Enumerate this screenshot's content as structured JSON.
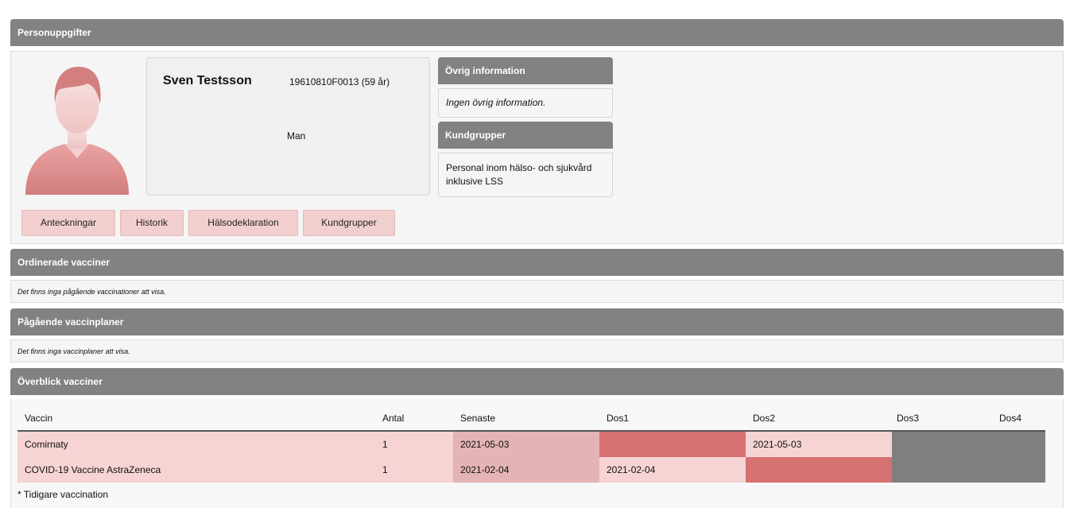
{
  "personal": {
    "header": "Personuppgifter",
    "name": "Sven Testsson",
    "id": "19610810F0013 (59 år)",
    "gender": "Man"
  },
  "other_info": {
    "header": "Övrig information",
    "text": "Ingen övrig information."
  },
  "customer_groups": {
    "header": "Kundgrupper",
    "text": "Personal inom hälso- och sjukvård inklusive LSS"
  },
  "buttons": {
    "notes": "Anteckningar",
    "history": "Historik",
    "health_declaration": "Hälsodeklaration",
    "customer_groups": "Kundgrupper"
  },
  "ordered": {
    "header": "Ordinerade vacciner",
    "empty": "Det finns inga pågående vaccinationer att visa."
  },
  "plans": {
    "header": "Pågående vaccinplaner",
    "empty": "Det finns inga vaccinplaner att visa."
  },
  "overview": {
    "header": "Överblick vacciner",
    "columns": [
      "Vaccin",
      "Antal",
      "Senaste",
      "Dos1",
      "Dos2",
      "Dos3",
      "Dos4"
    ],
    "rows": [
      {
        "vaccine": "Comirnaty",
        "count": "1",
        "latest": "2021-05-03",
        "dose1": "",
        "dose2": "2021-05-03",
        "dose3": "",
        "dose4": ""
      },
      {
        "vaccine": "COVID-19 Vaccine AstraZeneca",
        "count": "1",
        "latest": "2021-02-04",
        "dose1": "2021-02-04",
        "dose2": "",
        "dose3": "",
        "dose4": ""
      }
    ],
    "footnote": "* Tidigare vaccination"
  },
  "colors": {
    "header": "#828282",
    "row_bg": "#f6d4d4",
    "latest": "#e4b4b4",
    "missing_dose": "#d67171",
    "no_dose": "#7f7f7f",
    "button_bg": "#f2cfcf",
    "avatar": "#d98e8e"
  }
}
